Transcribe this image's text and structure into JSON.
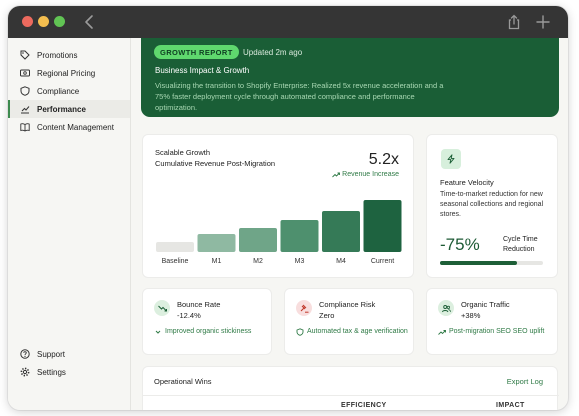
{
  "window": {
    "icons": [
      "back-icon",
      "share-icon",
      "plus-icon"
    ]
  },
  "sidebar": {
    "items": [
      {
        "label": "Promotions",
        "icon": "tag-icon"
      },
      {
        "label": "Regional Pricing",
        "icon": "cash-icon"
      },
      {
        "label": "Compliance",
        "icon": "shield-icon"
      },
      {
        "label": "Performance",
        "icon": "chart-icon",
        "active": true
      },
      {
        "label": "Content Management",
        "icon": "book-icon"
      }
    ],
    "bottom": [
      {
        "label": "Support",
        "icon": "help-icon"
      },
      {
        "label": "Settings",
        "icon": "gear-icon"
      }
    ]
  },
  "hero": {
    "badge": "GROWTH REPORT",
    "updated": "Updated 2m ago",
    "title": "Business Impact & Growth",
    "description": "Visualizing the transition to Shopify Enterprise: Realized 5x revenue acceleration and a 75% faster deployment cycle through automated compliance and performance optimization."
  },
  "growth": {
    "title": "Scalable Growth",
    "subtitle": "Cumulative Revenue Post-Migration",
    "big_value": "5.2x",
    "increase_label": "Revenue Increase"
  },
  "chart_data": {
    "type": "bar",
    "categories": [
      "Baseline",
      "M1",
      "M2",
      "M3",
      "M4",
      "Current"
    ],
    "values": [
      1.0,
      1.8,
      2.4,
      3.2,
      4.1,
      5.2
    ],
    "title": "",
    "xlabel": "",
    "ylabel": "",
    "ylim": [
      0,
      5.2
    ],
    "colors": [
      "#e6e6e3",
      "#8fb9a2",
      "#6fa588",
      "#4e906e",
      "#357a57",
      "#1e6340"
    ]
  },
  "velocity": {
    "title": "Feature Velocity",
    "description": "Time-to-market reduction for new seasonal collections and regional stores.",
    "big_value": "-75%",
    "label": "Cycle Time Reduction",
    "progress": 0.75
  },
  "metrics": [
    {
      "title": "Bounce Rate",
      "value": "-12.4%",
      "note": "Improved organic stickiness",
      "icon": "trend-down-icon",
      "icon_bg": "#dcefdf"
    },
    {
      "title": "Compliance Risk",
      "value": "Zero",
      "note": "Automated tax & age verification",
      "icon": "gavel-icon",
      "icon_bg": "#f8dede"
    },
    {
      "title": "Organic Traffic",
      "value": "+38%",
      "note": "Post-migration SEO SEO uplift",
      "icon": "users-icon",
      "icon_bg": "#dcefdf"
    }
  ],
  "ops": {
    "title": "Operational Wins",
    "link": "Export Log",
    "col_efficiency": "EFFICIENCY",
    "col_impact": "IMPACT"
  },
  "colors": {
    "accent_green": "#1a5e36",
    "badge_green": "#5fd86e",
    "link_green": "#2f7a46"
  }
}
